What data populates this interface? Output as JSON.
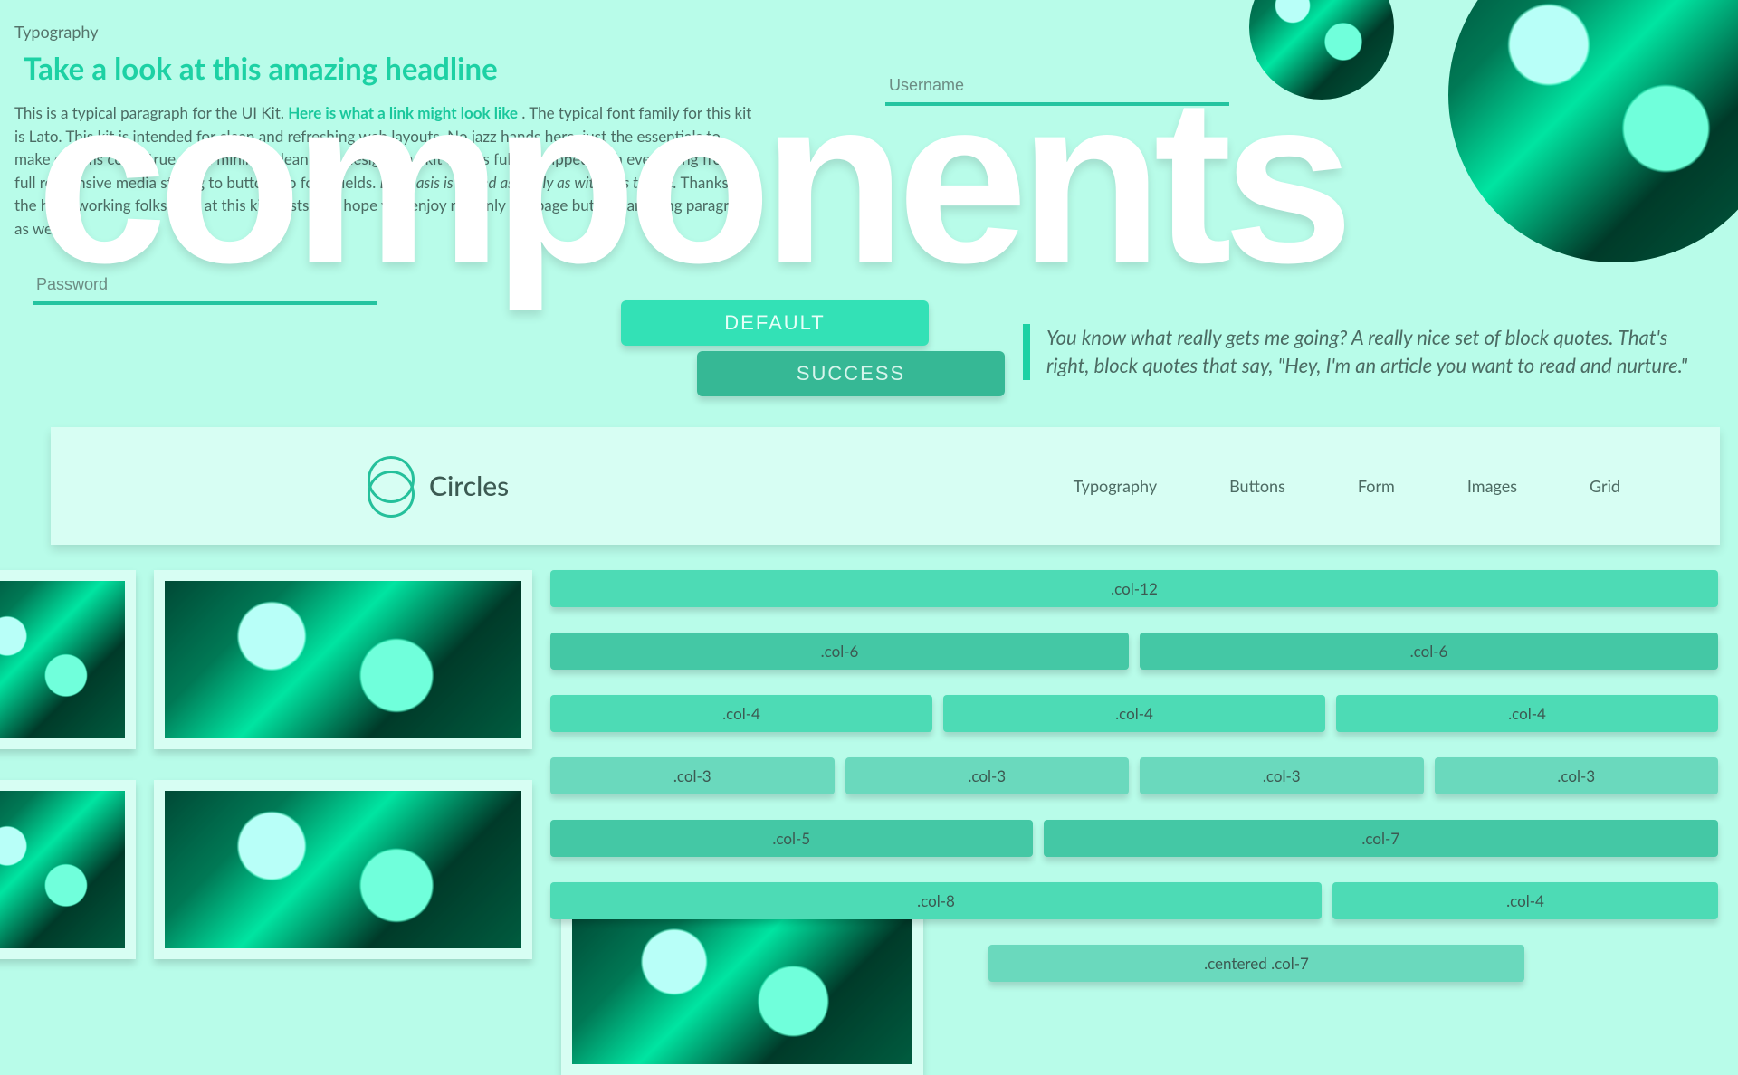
{
  "watermark": "components",
  "typography": {
    "label": "Typography",
    "headline": "Take a look at this amazing headline",
    "para_part1": "This is a typical paragraph for the UI Kit. ",
    "link_text": "Here is what a link might look like",
    "para_part2": ". The typical font family for this kit is Lato. This kit is intended for clean and refreshing web layouts. No jazz hands here, just the essentials to make dreams come true, with minimal clean web design. The kit comes fully equipped with everything from full responsive media styling to buttons to form fields. ",
    "emphasis": "Emphasis is added as easily as with this theme.",
    "para_part3": " Thanks to the hard-working folks over at this kit exists. We hope you enjoy not only the page but this amazing paragraph as well."
  },
  "inputs": {
    "username_placeholder": "Username",
    "password_placeholder": "Password"
  },
  "buttons": {
    "default": "DEFAULT",
    "success": "SUCCESS"
  },
  "blockquote": "You know what really gets me going? A really nice set of block quotes. That's right, block quotes that say, \"Hey, I'm an article you want to read and nurture.\"",
  "brand": "Circles",
  "nav": {
    "typography": "Typography",
    "buttons": "Buttons",
    "form": "Form",
    "images": "Images",
    "grid": "Grid"
  },
  "grid": {
    "c12": ".col-12",
    "c6": ".col-6",
    "c4": ".col-4",
    "c3": ".col-3",
    "c5": ".col-5",
    "c7": ".col-7",
    "c8": ".col-8",
    "centered7": ".centered .col-7"
  }
}
